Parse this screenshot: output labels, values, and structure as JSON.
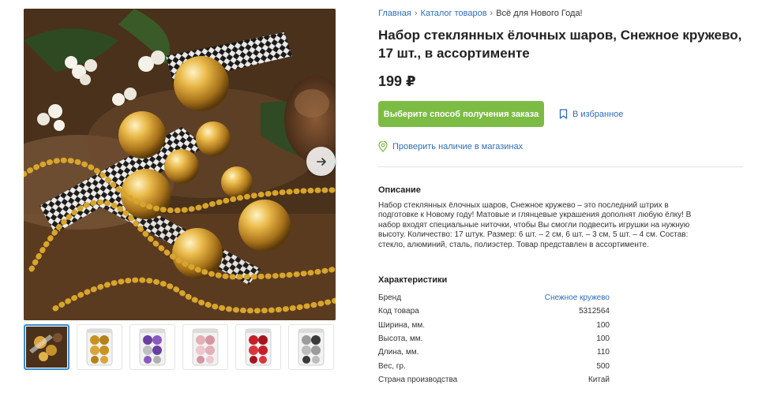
{
  "gallery": {
    "thumbnails": [
      {
        "name": "thumb-decor-scene"
      },
      {
        "name": "thumb-gold-balls",
        "color": "#c9921e"
      },
      {
        "name": "thumb-purple-balls",
        "color": "#6a3fa0"
      },
      {
        "name": "thumb-pink-balls",
        "color": "#e3b0b8"
      },
      {
        "name": "thumb-red-balls",
        "color": "#c4202a"
      },
      {
        "name": "thumb-silver-balls",
        "color": "#9c9c9c"
      }
    ]
  },
  "breadcrumb": {
    "home": "Главная",
    "catalog": "Каталог товаров",
    "current": "Всё для Нового Года!"
  },
  "product": {
    "title": "Набор стеклянных ёлочных шаров, Снежное кружево, 17 шт., в ассортименте",
    "price": "199 ₽",
    "order_button": "Выберите способ получения заказа",
    "favorite": "В избранное",
    "check_stores": "Проверить наличие в магазинах"
  },
  "description": {
    "title": "Описание",
    "text": "Набор стеклянных ёлочных шаров, Снежное кружево – это последний штрих в подготовке к Новому году! Матовые и глянцевые украшения дополнят любую ёлку! В набор входят специальные ниточки, чтобы Вы смогли подвесить игрушки на нужную высоту. Количество: 17 штук. Размер: 6 шт. – 2 см, 6 шт. – 3 см, 5 шт. – 4 см. Состав: стекло, алюминий, сталь, полиэстер. Товар представлен в ассортименте."
  },
  "characteristics": {
    "title": "Характеристики",
    "rows": [
      {
        "label": "Бренд",
        "value": "Снежное кружево"
      },
      {
        "label": "Код товара",
        "value": "5312564"
      },
      {
        "label": "Ширина, мм.",
        "value": "100"
      },
      {
        "label": "Высота, мм.",
        "value": "100"
      },
      {
        "label": "Длина, мм.",
        "value": "110"
      },
      {
        "label": "Вес, гр.",
        "value": "500"
      },
      {
        "label": "Страна производства",
        "value": "Китай"
      }
    ]
  },
  "colors": {
    "link": "#2f6db5",
    "accent_green": "#7cbc45"
  }
}
